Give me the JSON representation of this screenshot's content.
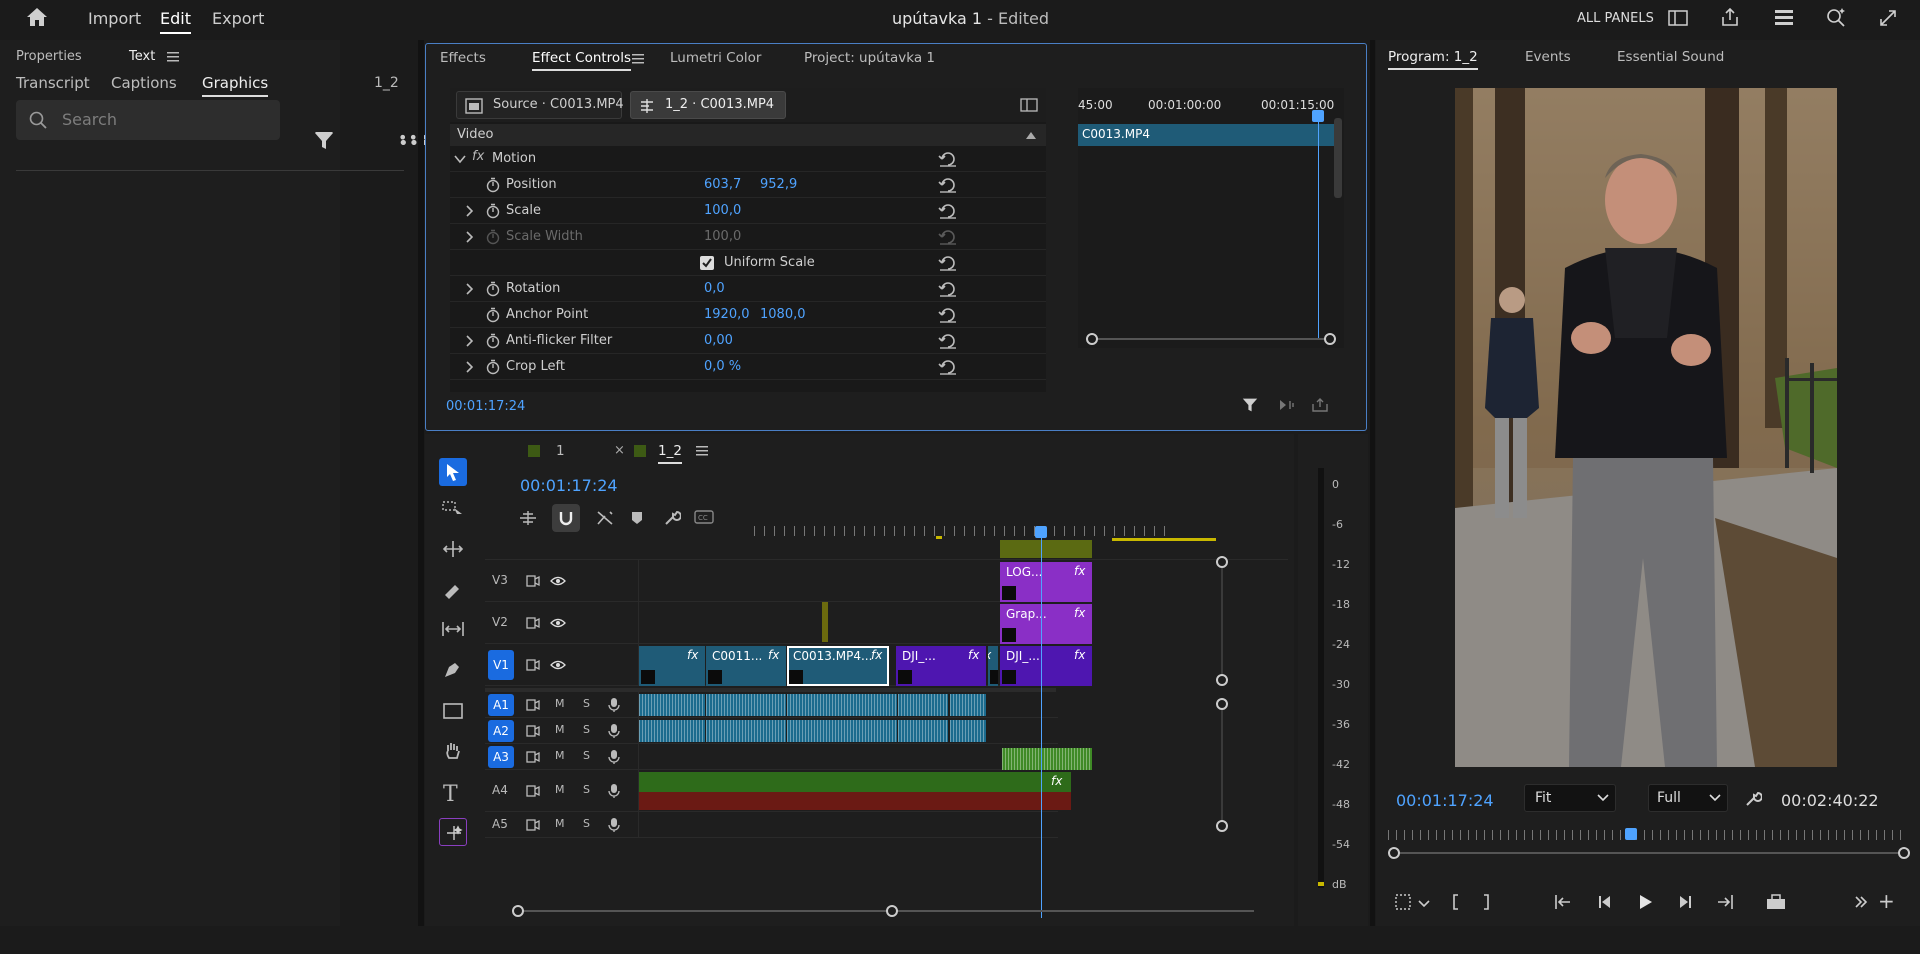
{
  "topbar": {
    "home": "home-icon",
    "menu": [
      "Import",
      "Edit",
      "Export"
    ],
    "active_menu": "Edit",
    "title_main": "upútavka 1",
    "title_suffix": " - Edited",
    "all_panels": "ALL PANELS"
  },
  "left_panel": {
    "tabs_top": [
      "Properties",
      "Text"
    ],
    "tabs_sub": [
      "Transcript",
      "Captions",
      "Graphics"
    ],
    "seq": "1_2",
    "search_placeholder": "Search"
  },
  "effect_controls": {
    "tabs": [
      "Effects",
      "Effect Controls",
      "Lumetri Color",
      "Project: upútavka 1"
    ],
    "source_label": "Source · C0013.MP4",
    "seq_label": "1_2 · C0013.MP4",
    "section": "Video",
    "motion": "Motion",
    "fx": "fx",
    "ruler": [
      "45:00",
      "00:01:00:00",
      "00:01:15:00"
    ],
    "clip_name": "C0013.MP4",
    "rows": [
      {
        "label": "Position",
        "v1": "603,7",
        "v2": "952,9",
        "expand": false
      },
      {
        "label": "Scale",
        "v1": "100,0",
        "v2": "",
        "expand": true
      },
      {
        "label": "Scale Width",
        "v1": "100,0",
        "v2": "",
        "expand": true,
        "disabled": true
      },
      {
        "label": "Uniform Scale",
        "v1": "",
        "v2": "",
        "checkbox": true
      },
      {
        "label": "Rotation",
        "v1": "0,0",
        "v2": "",
        "expand": true
      },
      {
        "label": "Anchor Point",
        "v1": "1920,0",
        "v2": "1080,0",
        "expand": false
      },
      {
        "label": "Anti-flicker Filter",
        "v1": "0,00",
        "v2": "",
        "expand": true
      },
      {
        "label": "Crop Left",
        "v1": "0,0 %",
        "v2": "",
        "expand": true
      }
    ],
    "timecode": "00:01:17:24"
  },
  "program": {
    "tabs": [
      "Program: 1_2",
      "Events",
      "Essential Sound"
    ],
    "timecode": "00:01:17:24",
    "fit": "Fit",
    "quality": "Full",
    "duration": "00:02:40:22",
    "playhead_fraction": 0.47
  },
  "timeline": {
    "tabs": [
      "1",
      "1_2"
    ],
    "timecode": "00:01:17:24",
    "video_tracks": [
      {
        "id": "V3",
        "target": "V3"
      },
      {
        "id": "V2",
        "target": "V2"
      },
      {
        "id": "V1",
        "target": "V1"
      }
    ],
    "audio_tracks": [
      {
        "id": "A1",
        "target": "A1"
      },
      {
        "id": "A2",
        "target": "A2"
      },
      {
        "id": "A3",
        "target": "A3"
      },
      {
        "id": "A4",
        "target": "A4"
      },
      {
        "id": "A5",
        "target": "A5"
      }
    ],
    "m_label": "M",
    "s_label": "S",
    "clips": {
      "v1a": "C0011...",
      "v1b": "C0013.MP4...",
      "v1c": "DJI_...",
      "v1d": "DJI_...",
      "v3": "LOG...",
      "v2": "Grap..."
    }
  },
  "meter": {
    "ticks": [
      "0",
      "-6",
      "-12",
      "-18",
      "-24",
      "-30",
      "-36",
      "-42",
      "-48",
      "-54",
      "dB"
    ]
  },
  "colors": {
    "accent": "#1a6be0",
    "timecode": "#4fa3ff",
    "v1clip": "#1f5b77",
    "purple": "#8a2fc6",
    "green": "#2e6b1a",
    "red": "#6b1a14"
  }
}
